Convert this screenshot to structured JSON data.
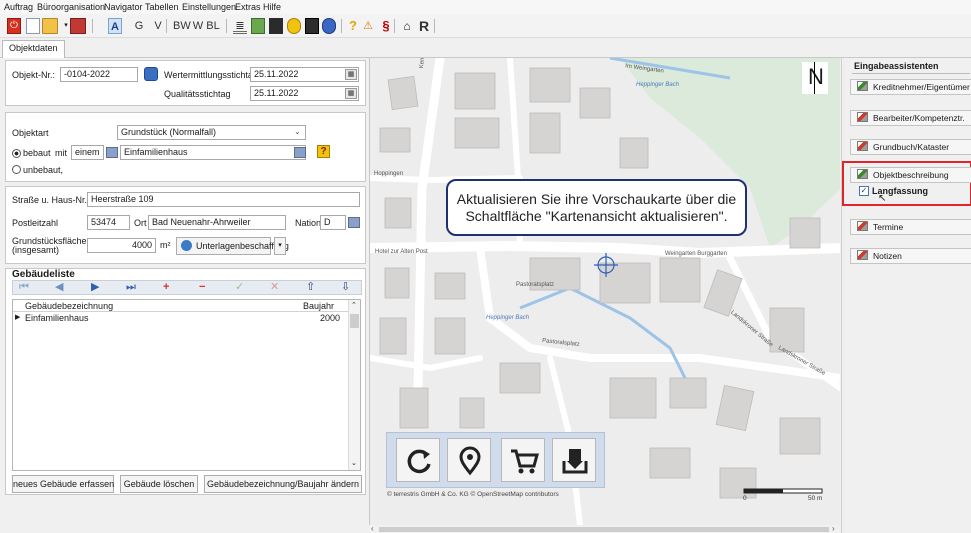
{
  "menu": [
    "Auftrag",
    "Büroorganisation",
    "Navigator",
    "Tabellen",
    "Einstellungen",
    "Extras",
    "Hilfe"
  ],
  "toolbar": {
    "letters": [
      "A",
      "G",
      "V",
      "BW",
      "W",
      "BL",
      "§",
      "R"
    ]
  },
  "tabs": {
    "active": "Objektdaten"
  },
  "objekt": {
    "nr_label": "Objekt-Nr.:",
    "nr_value": "-0104-2022",
    "wertermittlung_label": "Wertermittlungsstichtag",
    "wertermittlung_value": "25.11.2022",
    "qualitaet_label": "Qualitätsstichtag",
    "qualitaet_value": "25.11.2022"
  },
  "objektart": {
    "label": "Objektart",
    "value": "Grundstück (Normalfall)",
    "bebaut_label": "bebaut",
    "mit_label": "mit",
    "count_value": "einem",
    "haustyp_value": "Einfamilienhaus",
    "unbebaut_label": "unbebaut,"
  },
  "adresse": {
    "strasse_label": "Straße u. Haus-Nr.",
    "strasse_value": "Heerstraße 109",
    "plz_label": "Postleitzahl",
    "plz_value": "53474",
    "ort_label": "Ort",
    "ort_value": "Bad Neuenahr-Ahrweiler",
    "nation_label": "Nation",
    "nation_value": "D",
    "flaeche_label_1": "Grundstücksfläche",
    "flaeche_label_2": "(insgesamt)",
    "flaeche_value": "4000",
    "flaeche_unit": "m²",
    "unterlagen_label": "Unterlagenbeschaffung"
  },
  "gebaeude": {
    "title": "Gebäudeliste",
    "columns": [
      "Gebäudebezeichnung",
      "Baujahr"
    ],
    "rows": [
      {
        "name": "Einfamilienhaus",
        "baujahr": "2000"
      }
    ],
    "btn_new": "neues Gebäude erfassen",
    "btn_delete": "Gebäude löschen",
    "btn_edit": "Gebäudebezeichnung/Baujahr ändern"
  },
  "map": {
    "tooltip": "Aktualisieren Sie ihre Vorschaukarte über die Schaltfläche \"Kartenansicht aktualisieren\".",
    "attribution": "© terrestris GmbH & Co. KG  © OpenStreetMap contributors",
    "scale_start": "0",
    "scale_end": "50 m",
    "north": "N",
    "streets": {
      "kemplingasse": "Kemplingasse",
      "im_weingarten": "Im Weingarten",
      "hoppinger_bach_top": "Heppinger Bach",
      "hotel_zur_alten_post": "Hotel zur Alten Post",
      "weingarten_burggarten": "Weingarten Burggarten",
      "pastoratplatz": "Pastoratsplatz",
      "hoppinger_bach_mid": "Heppinger Bach",
      "pastoralsplatz": "Pastoralsplatz",
      "landskroner_strasse": "Landskroner Straße",
      "landskrone": "Landskroner Straße",
      "hoppingen": "Hoppingen"
    }
  },
  "assistants": {
    "title": "Eingabeassistenten",
    "items": [
      {
        "label": "Kreditnehmer/Eigentümer",
        "done": true
      },
      {
        "label": "Bearbeiter/Kompetenztr.",
        "done": false
      },
      {
        "label": "Grundbuch/Kataster",
        "done": false
      },
      {
        "label": "Objektbeschreibung",
        "done": true
      },
      {
        "label": "Termine",
        "done": false
      },
      {
        "label": "Notizen",
        "done": false
      }
    ],
    "langfassung_label": "Langfassung",
    "highlight_color": "#e0242b"
  }
}
